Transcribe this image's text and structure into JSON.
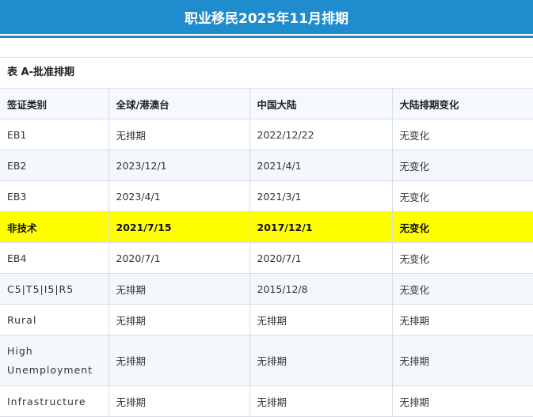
{
  "header": {
    "title": "职业移民2025年11月排期"
  },
  "table": {
    "caption": "表 A-批准排期",
    "columns": [
      "签证类别",
      "全球/港澳台",
      "中国大陆",
      "大陆排期变化"
    ],
    "rows": [
      {
        "cells": [
          "EB1",
          "无排期",
          "2022/12/22",
          "无变化"
        ]
      },
      {
        "cells": [
          "EB2",
          "2023/12/1",
          "2021/4/1",
          "无变化"
        ]
      },
      {
        "cells": [
          "EB3",
          "2023/4/1",
          "2021/3/1",
          "无变化"
        ]
      },
      {
        "cells": [
          "非技术",
          "2021/7/15",
          "2017/12/1",
          "无变化"
        ],
        "highlight": true
      },
      {
        "cells": [
          "EB4",
          "2020/7/1",
          "2020/7/1",
          "无变化"
        ]
      },
      {
        "cells": [
          "C5|T5|I5|R5",
          "无排期",
          "2015/12/8",
          "无变化"
        ]
      },
      {
        "cells": [
          "Rural",
          "无排期",
          "无排期",
          "无排期"
        ]
      },
      {
        "cells": [
          "High Unemployment",
          "无排期",
          "无排期",
          "无排期"
        ],
        "tall": true
      },
      {
        "cells": [
          "Infrastructure",
          "无排期",
          "无排期",
          "无排期"
        ]
      }
    ]
  },
  "colors": {
    "header_bg": "#1e8ccd",
    "highlight_bg": "#ffff00",
    "border": "#d8dde6"
  }
}
